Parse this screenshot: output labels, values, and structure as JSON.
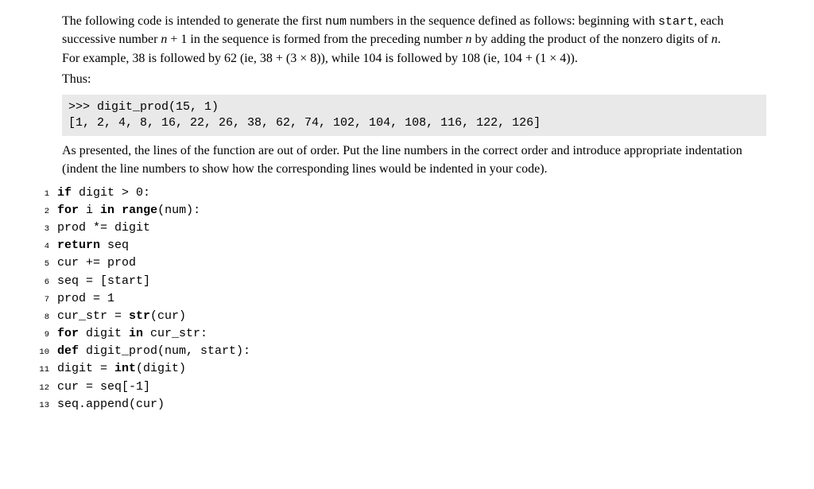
{
  "passage": {
    "para1_html": "The following code is intended to generate the first <span class=\"tt\">num</span> numbers in the sequence defined as follows: beginning with <span class=\"tt\">start</span>, each successive number <span class=\"math-var\">n</span> + 1 in the sequence is formed from the preceding number <span class=\"math-var\">n</span> by adding the product of the nonzero digits of <span class=\"math-var\">n</span>.",
    "para2_html": "For example, 38 is followed by 62 (ie, 38 + (3 × 8)), while 104 is followed by 108 (ie, 104 + (1 × 4)).",
    "para3_html": "Thus:"
  },
  "console": {
    "input": ">>> digit_prod(15, 1)",
    "output": "[1, 2, 4, 8, 16, 22, 26, 38, 62, 74, 102, 104, 108, 116, 122, 126]"
  },
  "passage2": {
    "para1_html": "As presented, the lines of the function are out of order. Put the line numbers in the correct order and introduce appropriate indentation (indent the line numbers to show how the corresponding lines would be indented in your code)."
  },
  "code": {
    "lines": [
      {
        "n": "1",
        "html": "<span class=\"kw\">if</span> digit > 0:"
      },
      {
        "n": "2",
        "html": "<span class=\"kw\">for</span> i <span class=\"kw\">in</span> <span class=\"kw\">range</span>(num):"
      },
      {
        "n": "3",
        "html": "prod *= digit"
      },
      {
        "n": "4",
        "html": "<span class=\"kw\">return</span> seq"
      },
      {
        "n": "5",
        "html": "cur += prod"
      },
      {
        "n": "6",
        "html": "seq = [start]"
      },
      {
        "n": "7",
        "html": "prod = 1"
      },
      {
        "n": "8",
        "html": "cur_str = <span class=\"kw\">str</span>(cur)"
      },
      {
        "n": "9",
        "html": "<span class=\"kw\">for</span> digit <span class=\"kw\">in</span> cur_str:"
      },
      {
        "n": "10",
        "html": "<span class=\"kw\">def</span> digit_prod(num, start):"
      },
      {
        "n": "11",
        "html": "digit = <span class=\"kw\">int</span>(digit)"
      },
      {
        "n": "12",
        "html": "cur = seq[-1]"
      },
      {
        "n": "13",
        "html": "seq.append(cur)"
      }
    ]
  }
}
